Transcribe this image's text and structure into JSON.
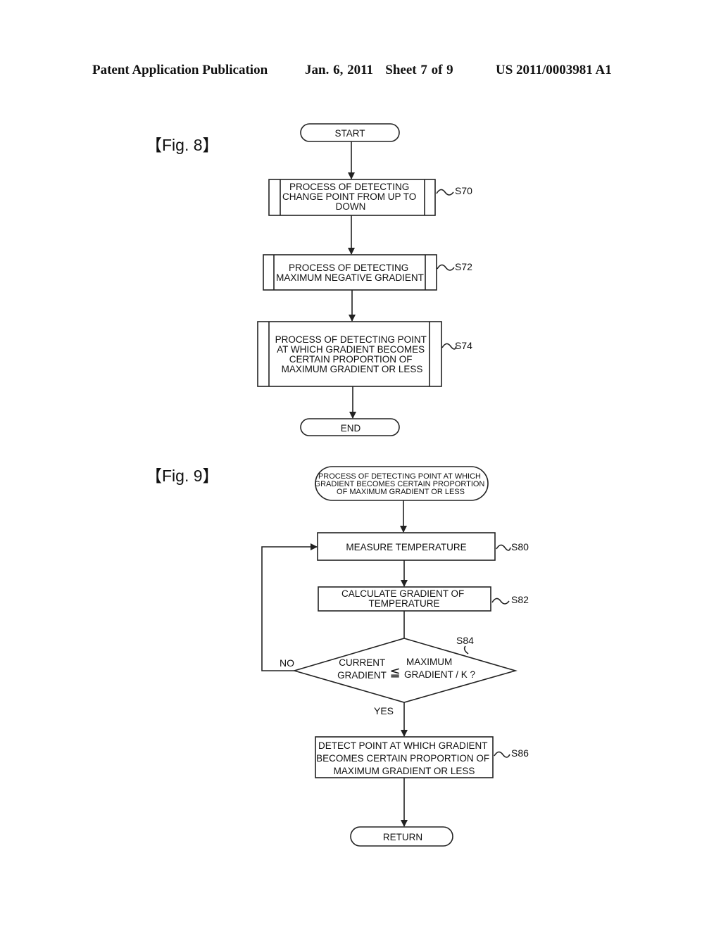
{
  "header": {
    "publication": "Patent Application Publication",
    "date_sheet": "Jan. 6, 2011   Sheet 7 of 9",
    "number": "US 2011/0003981 A1"
  },
  "fig8": {
    "label": "【Fig. 8】",
    "start": "START",
    "end": "END",
    "steps": [
      {
        "id": "S70",
        "lines": [
          "PROCESS OF DETECTING",
          "CHANGE POINT FROM UP TO",
          "DOWN"
        ]
      },
      {
        "id": "S72",
        "lines": [
          "PROCESS OF   DETECTING",
          "MAXIMUM NEGATIVE GRADIENT"
        ]
      },
      {
        "id": "S74",
        "lines": [
          "PROCESS OF   DETECTING POINT",
          "AT WHICH GRADIENT BECOMES",
          "CERTAIN PROPORTION OF",
          "MAXIMUM GRADIENT OR LESS"
        ]
      }
    ]
  },
  "fig9": {
    "label": "【Fig. 9】",
    "start_lines": [
      "PROCESS OF   DETECTING POINT AT WHICH",
      "GRADIENT BECOMES CERTAIN PROPORTION",
      "OF MAXIMUM GRADIENT OR LESS"
    ],
    "steps": [
      {
        "id": "S80",
        "lines": [
          "MEASURE TEMPERATURE"
        ]
      },
      {
        "id": "S82",
        "lines": [
          "CALCULATE GRADIENT OF",
          "TEMPERATURE"
        ]
      }
    ],
    "decision": {
      "id": "S84",
      "left_lines": [
        "CURRENT",
        "GRADIENT"
      ],
      "operator": "≦",
      "right_lines": [
        "MAXIMUM",
        "GRADIENT / K ?"
      ],
      "no_label": "NO",
      "yes_label": "YES"
    },
    "final_step": {
      "id": "S86",
      "lines": [
        "DETECT POINT AT WHICH GRADIENT",
        "BECOMES CERTAIN PROPORTION OF",
        "MAXIMUM GRADIENT OR LESS"
      ]
    },
    "return": "RETURN"
  }
}
